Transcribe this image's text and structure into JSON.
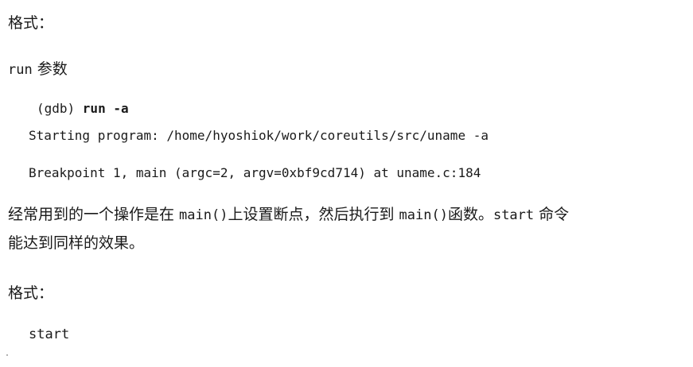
{
  "section1": {
    "format_label": "格式：",
    "syntax_cmd": "run",
    "syntax_arg": " 参数"
  },
  "example1": {
    "prompt": "(gdb) ",
    "command": "run -a",
    "output_line1": "Starting program: /home/hyoshiok/work/coreutils/src/uname -a",
    "output_line2": "Breakpoint 1, main (argc=2, argv=0xbf9cd714) at uname.c:184"
  },
  "paragraph": {
    "line1_part1": "经常用到的一个操作是在 ",
    "line1_code1": "main()",
    "line1_part2": "上设置断点，然后执行到 ",
    "line1_code2": "main()",
    "line1_part3": "函数。",
    "line1_code3": "start",
    "line1_part4": " 命令",
    "line2": "能达到同样的效果。"
  },
  "section2": {
    "format_label": "格式：",
    "syntax_cmd": "start"
  }
}
